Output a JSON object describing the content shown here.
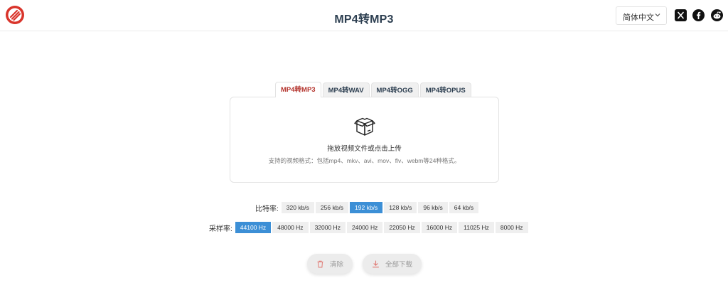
{
  "header": {
    "title": "MP4转MP3",
    "language": "简体中文",
    "social": [
      "x-icon",
      "facebook-icon",
      "reddit-icon"
    ]
  },
  "tabs": [
    {
      "label": "MP4转MP3",
      "active": true
    },
    {
      "label": "MP4转WAV",
      "active": false
    },
    {
      "label": "MP4转OGG",
      "active": false
    },
    {
      "label": "MP4转OPUS",
      "active": false
    }
  ],
  "upload": {
    "title": "拖放视频文件或点击上传",
    "formats": "支持的视频格式：包括mp4、mkv、avi、mov、flv、webm等24种格式。"
  },
  "bitrate": {
    "label": "比特率:",
    "options": [
      "320 kb/s",
      "256 kb/s",
      "192 kb/s",
      "128 kb/s",
      "96 kb/s",
      "64 kb/s"
    ],
    "selected": "192 kb/s"
  },
  "sample_rate": {
    "label": "采样率:",
    "options": [
      "44100 Hz",
      "48000 Hz",
      "32000 Hz",
      "24000 Hz",
      "22050 Hz",
      "16000 Hz",
      "11025 Hz",
      "8000 Hz"
    ],
    "selected": "44100 Hz"
  },
  "actions": {
    "clear": "清除",
    "download_all": "全部下载"
  },
  "colors": {
    "title": "#2c3e50",
    "active_tab": "#b3312a",
    "selected_option": "#3c8fd6",
    "logo_red": "#d9342b"
  }
}
